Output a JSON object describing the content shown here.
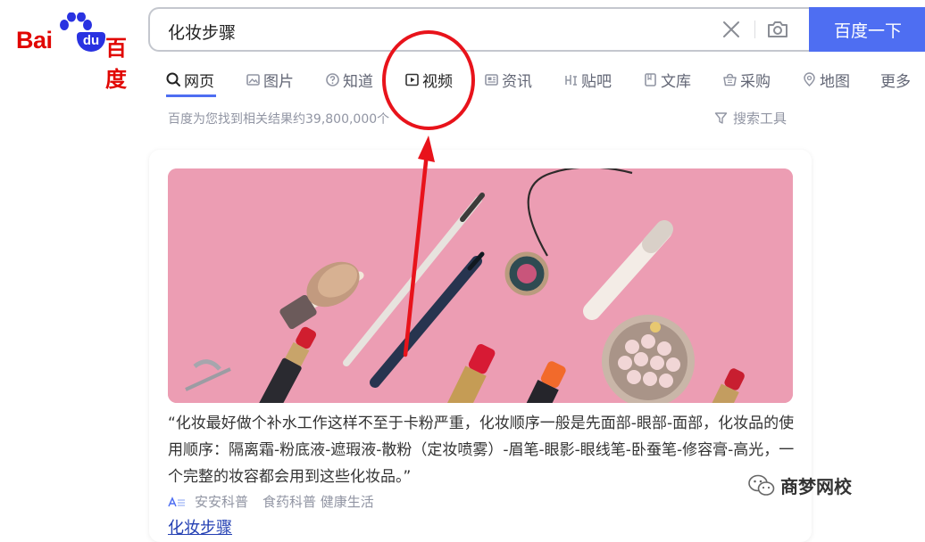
{
  "logo": {
    "text_latin": "Bai",
    "text_du": "du",
    "text_cn": "百度"
  },
  "search": {
    "query": "化妆步骤",
    "button_label": "百度一下"
  },
  "tabs": [
    {
      "label": "网页",
      "icon": "search-icon",
      "active": true
    },
    {
      "label": "图片",
      "icon": "image-icon"
    },
    {
      "label": "知道",
      "icon": "question-icon"
    },
    {
      "label": "视频",
      "icon": "play-icon"
    },
    {
      "label": "资讯",
      "icon": "news-icon"
    },
    {
      "label": "贴吧",
      "icon": "tieba-icon"
    },
    {
      "label": "文库",
      "icon": "doc-icon"
    },
    {
      "label": "采购",
      "icon": "basket-icon"
    },
    {
      "label": "地图",
      "icon": "map-icon"
    },
    {
      "label": "更多",
      "icon": ""
    }
  ],
  "results": {
    "count_text": "百度为您找到相关结果约39,800,000个",
    "tools_label": "搜索工具"
  },
  "card": {
    "snippet": "“化妆最好做个补水工作这样不至于卡粉严重，化妆顺序一般是先面部-眼部-面部，化妆品的使用顺序：隔离霜-粉底液-遮瑕液-散粉（定妆喷雾）-眉笔-眼影-眼线笔-卧蚕笔-修容膏-高光，一个完整的妆容都会用到这些化妆品。”",
    "source_name": "安安科普",
    "source_tags": "食药科普 健康生活",
    "link_text": "化妆步骤"
  },
  "watermark": {
    "text": "商梦网校"
  },
  "colors": {
    "accent": "#4e6ef2",
    "brand_red": "#e10602",
    "annotation_red": "#e8131b",
    "image_pink": "#ec9db3"
  }
}
